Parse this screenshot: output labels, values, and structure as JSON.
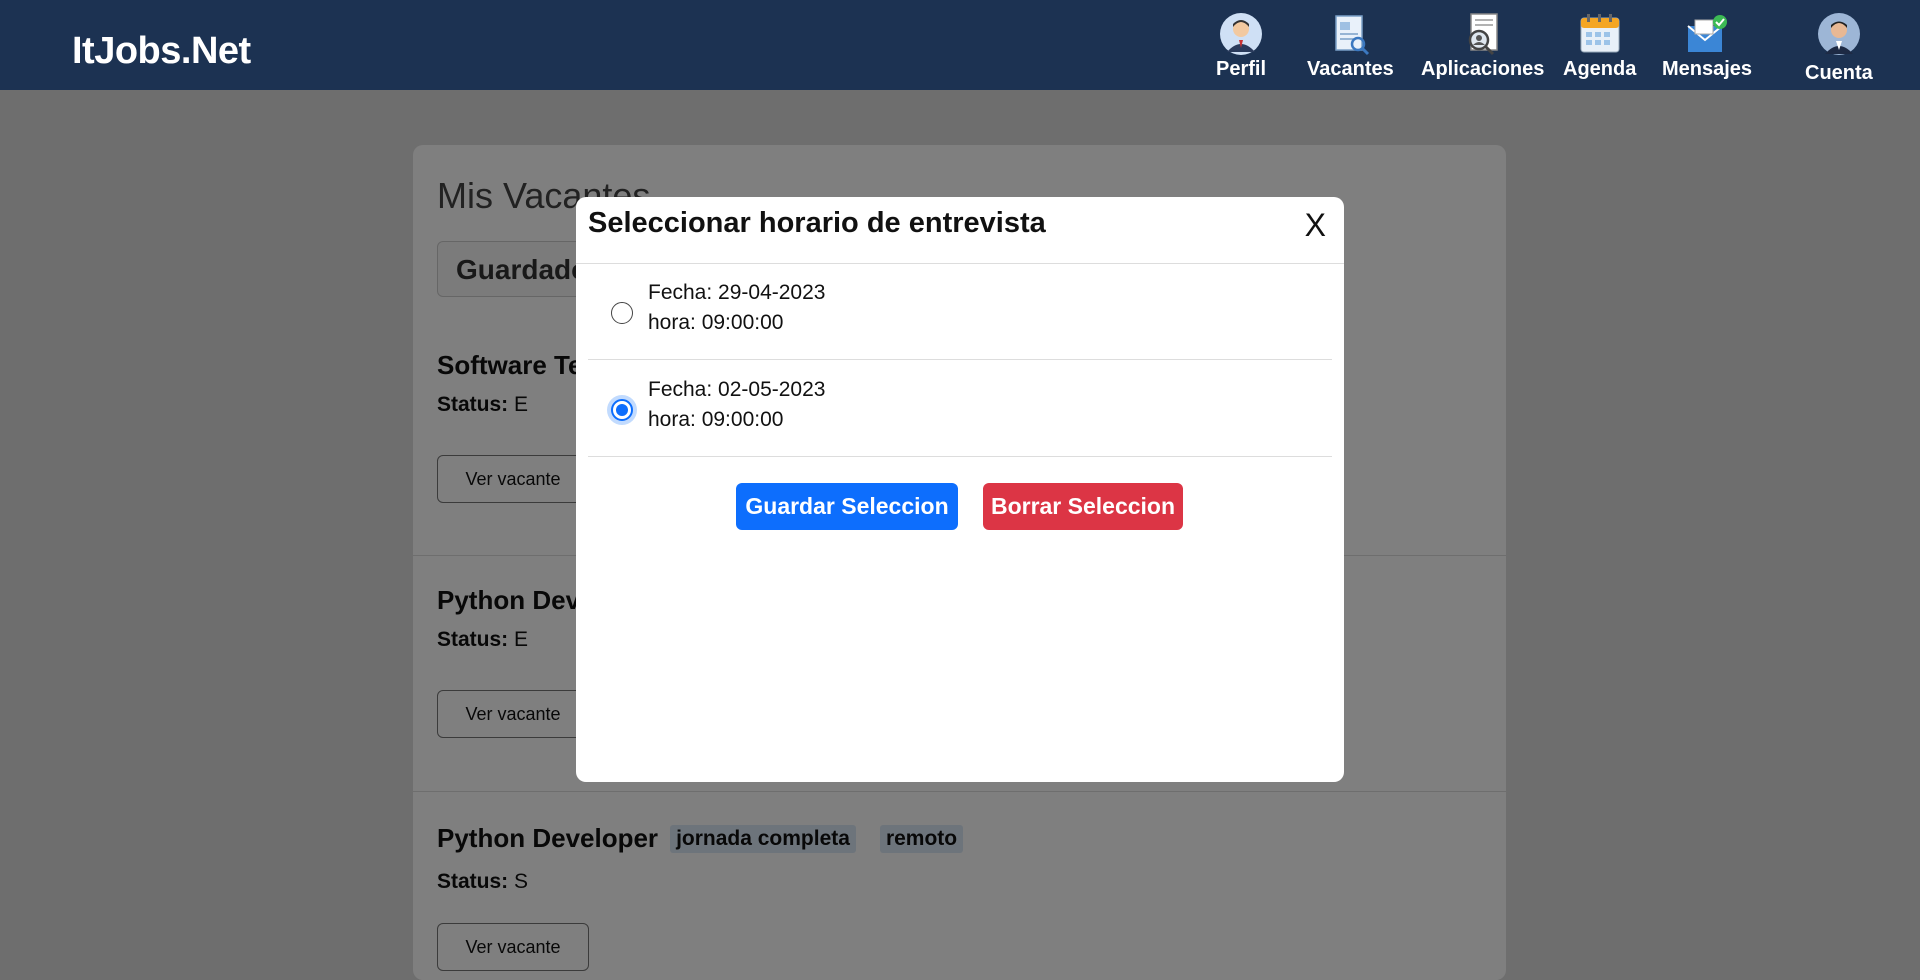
{
  "header": {
    "brand": "ItJobs.Net",
    "nav": [
      {
        "label": "Perfil",
        "icon": "profile-icon"
      },
      {
        "label": "Vacantes",
        "icon": "vacancies-icon"
      },
      {
        "label": "Aplicaciones",
        "icon": "applications-icon"
      },
      {
        "label": "Agenda",
        "icon": "calendar-icon"
      },
      {
        "label": "Mensajes",
        "icon": "messages-icon"
      },
      {
        "label": "Cuenta",
        "icon": "account-avatar-icon"
      }
    ]
  },
  "main": {
    "title": "Mis Vacantes",
    "tab": "Guardado",
    "jobs": [
      {
        "title": "Software Te",
        "status_label": "Status:",
        "status": "E",
        "button": "Ver vacante",
        "tags": []
      },
      {
        "title": "Python Dev",
        "status_label": "Status:",
        "status": "E",
        "button": "Ver vacante",
        "tags": []
      },
      {
        "title": "Python Developer",
        "status_label": "Status:",
        "status": "S",
        "button": "Ver vacante",
        "tags": [
          "jornada completa",
          "remoto"
        ]
      }
    ]
  },
  "modal": {
    "title": "Seleccionar horario de entrevista",
    "close": "X",
    "options": [
      {
        "fecha": "Fecha: 29-04-2023",
        "hora": "hora: 09:00:00",
        "checked": false
      },
      {
        "fecha": "Fecha: 02-05-2023",
        "hora": "hora: 09:00:00",
        "checked": true
      }
    ],
    "save_button": "Guardar Seleccion",
    "clear_button": "Borrar Seleccion"
  },
  "colors": {
    "navbar": "#1c3252",
    "primary": "#0d6efd",
    "danger": "#dc3545"
  }
}
